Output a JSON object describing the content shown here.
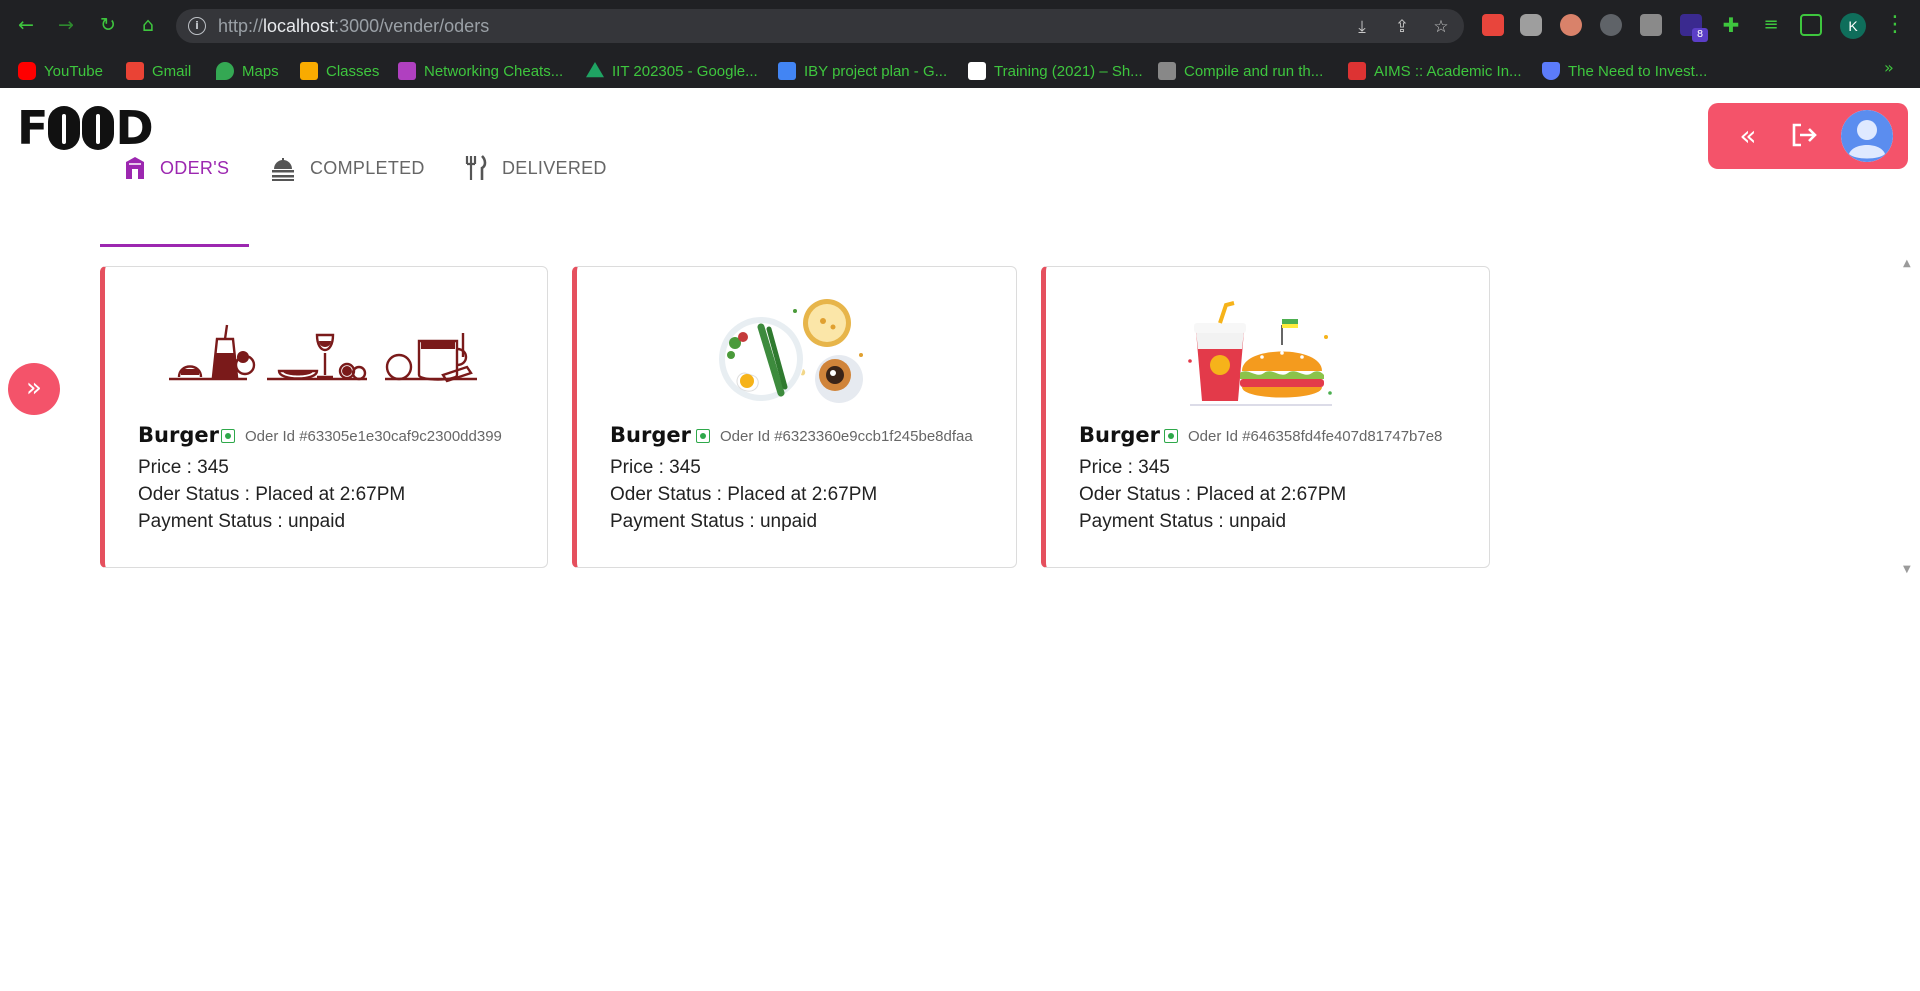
{
  "browser": {
    "url_scheme": "http://",
    "url_host": "localhost",
    "url_path": ":3000/vender/oders",
    "profile_initial": "K",
    "extension_badge": "8",
    "bookmarks": [
      {
        "label": "YouTube",
        "icon": "youtube-icon",
        "color": "#ff0000"
      },
      {
        "label": "Gmail",
        "icon": "gmail-icon",
        "color": "#ea4335"
      },
      {
        "label": "Maps",
        "icon": "maps-icon",
        "color": "#34a853"
      },
      {
        "label": "Classes",
        "icon": "classroom-icon",
        "color": "#f9ab00"
      },
      {
        "label": "Networking Cheats...",
        "icon": "network-icon",
        "color": "#b040c0"
      },
      {
        "label": "IIT 202305 - Google...",
        "icon": "drive-icon",
        "color": "#1fa463"
      },
      {
        "label": "IBY project plan - G...",
        "icon": "docs-icon",
        "color": "#4285f4"
      },
      {
        "label": "Training (2021) – Sh...",
        "icon": "training-icon",
        "color": "#ffffff"
      },
      {
        "label": "Compile and run th...",
        "icon": "cc-icon",
        "color": "#888888"
      },
      {
        "label": "AIMS :: Academic In...",
        "icon": "aims-icon",
        "color": "#d33"
      },
      {
        "label": "The Need to Invest...",
        "icon": "shield-icon",
        "color": "#5c7cfa"
      }
    ]
  },
  "app": {
    "logo_left": "F",
    "logo_right": "D",
    "accent": "#f4536a",
    "tab_accent": "#9c27b0",
    "tabs": [
      {
        "label": "ODER'S",
        "icon": "store-icon"
      },
      {
        "label": "COMPLETED",
        "icon": "food-cart-icon"
      },
      {
        "label": "DELIVERED",
        "icon": "fork-knife-icon"
      }
    ],
    "orders": [
      {
        "title": "Burger",
        "order_id": "Oder Id #63305e1e30caf9c2300dd399",
        "price": "Price : 345",
        "status": "Oder Status : Placed at 2:67PM",
        "payment": "Payment Status : unpaid",
        "image": "food-line-art-illustration"
      },
      {
        "title": "Burger",
        "order_id": "Oder Id #6323360e9ccb1f245be8dfaa",
        "price": "Price : 345",
        "status": "Oder Status : Placed at 2:67PM",
        "payment": "Payment Status : unpaid",
        "image": "breakfast-plate-illustration"
      },
      {
        "title": "Burger",
        "order_id": "Oder Id #646358fd4fe407d81747b7e8",
        "price": "Price : 345",
        "status": "Oder Status : Placed at 2:67PM",
        "payment": "Payment Status : unpaid",
        "image": "burger-and-drink-illustration"
      }
    ]
  }
}
